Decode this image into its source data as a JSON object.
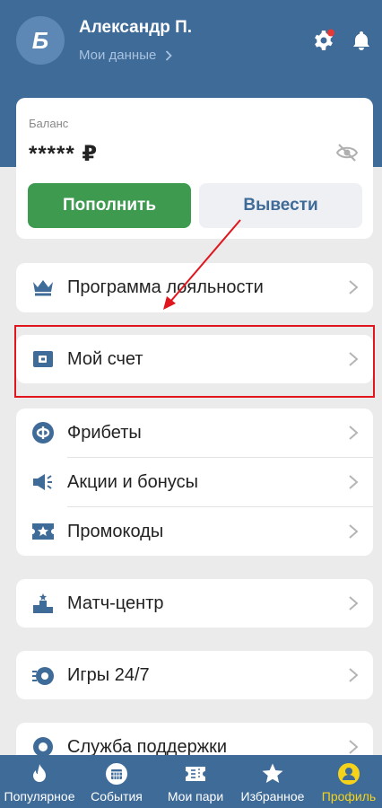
{
  "header": {
    "avatar_letter": "Б",
    "user_name": "Александр П.",
    "my_data_link": "Мои данные",
    "notification_dot_color": "#e53935"
  },
  "balance": {
    "label": "Баланс",
    "amount": "*****",
    "currency": "₽",
    "deposit_button": "Пополнить",
    "withdraw_button": "Вывести"
  },
  "menu": {
    "loyalty": "Программа лояльности",
    "my_account": "Мой счет",
    "freebets": "Фрибеты",
    "promotions": "Акции и бонусы",
    "promocodes": "Промокоды",
    "match_center": "Матч-центр",
    "games": "Игры 24/7",
    "support": "Служба поддержки"
  },
  "bottom_nav": [
    {
      "label": "Популярное",
      "icon": "flame-icon"
    },
    {
      "label": "События",
      "icon": "events-icon"
    },
    {
      "label": "Мои пари",
      "icon": "ticket-icon"
    },
    {
      "label": "Избранное",
      "icon": "star-icon"
    },
    {
      "label": "Профиль",
      "icon": "profile-icon",
      "active": true
    }
  ],
  "colors": {
    "header_blue": "#3f6b99",
    "accent_green": "#3d9a4f",
    "annotation_red": "#e0151d",
    "active_yellow": "#f5d31b"
  }
}
